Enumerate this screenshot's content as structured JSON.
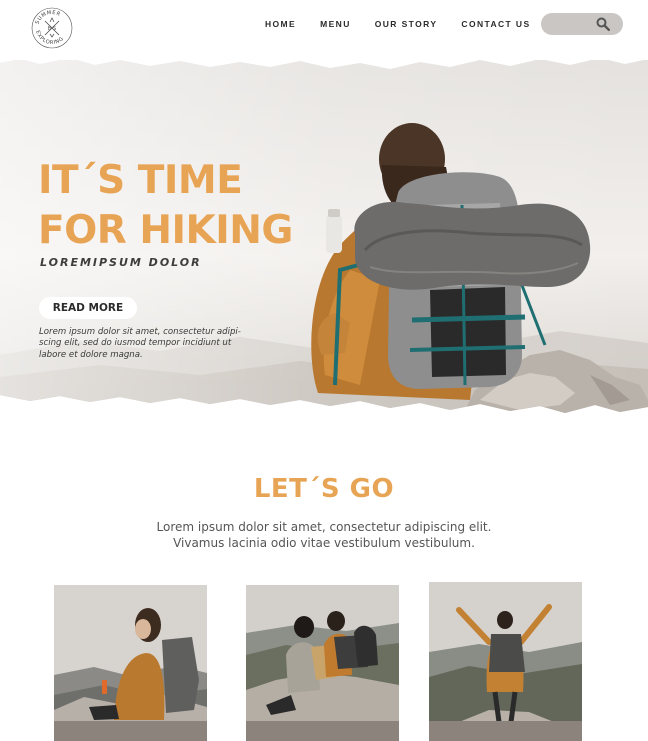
{
  "brand": {
    "logo_top": "SUMMER",
    "logo_bottom": "EXPLORING",
    "logo_letters": "B  S"
  },
  "nav": {
    "items": [
      "HOME",
      "MENU",
      "OUR STORY",
      "CONTACT US"
    ]
  },
  "search": {
    "placeholder": "",
    "icon": "search-icon"
  },
  "hero": {
    "title_line1": "IT´S TIME",
    "title_line2": "FOR HIKING",
    "subtitle": "LOREMIPSUM DOLOR",
    "cta_label": "READ MORE",
    "description": "Lorem ipsum dolor sit amet, consectetur adipi-scing elit, sed do iusmod tempor incidiunt ut labore et dolore magna."
  },
  "section": {
    "title": "LET´S GO",
    "text_line1": "Lorem ipsum dolor sit amet, consectetur adipiscing elit.",
    "text_line2": "Vivamus lacinia odio vitae vestibulum vestibulum."
  },
  "colors": {
    "accent": "#e8a455",
    "search_bg": "#c9c6c4",
    "card_bar": "#8c837d"
  }
}
